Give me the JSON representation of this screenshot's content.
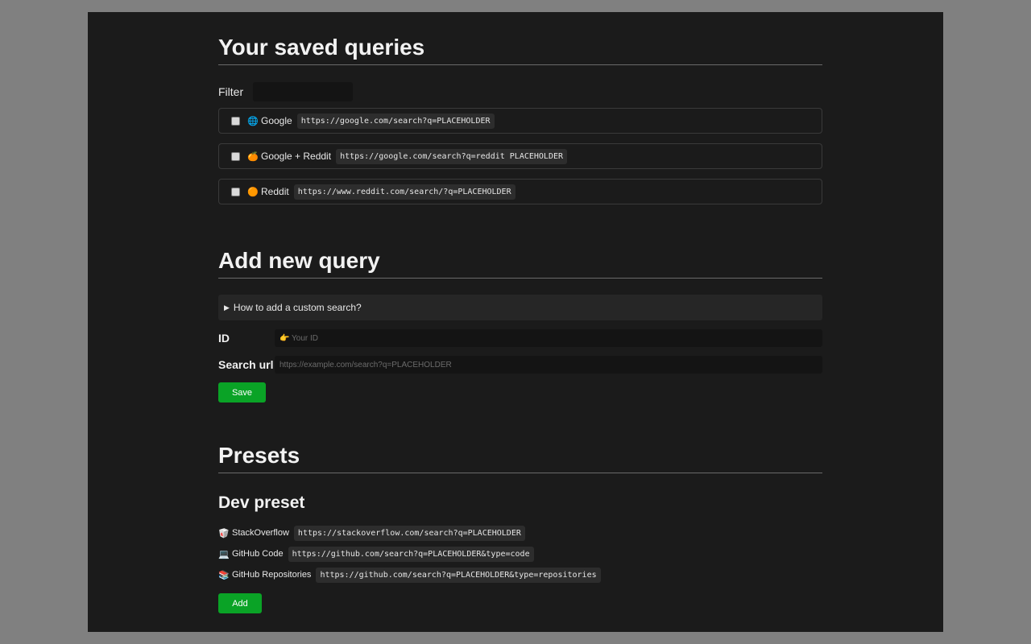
{
  "saved": {
    "title": "Your saved queries",
    "filter_label": "Filter",
    "filter_value": "",
    "items": [
      {
        "icon": "🌐",
        "icon_name": "globe-icon",
        "name": "Google",
        "url": "https://google.com/search?q=PLACEHOLDER"
      },
      {
        "icon": "🍊",
        "icon_name": "orange-icon",
        "name": "Google + Reddit",
        "url": "https://google.com/search?q=reddit PLACEHOLDER"
      },
      {
        "icon": "🟠",
        "icon_name": "orange-circle-icon",
        "name": "Reddit",
        "url": "https://www.reddit.com/search/?q=PLACEHOLDER"
      }
    ]
  },
  "add": {
    "title": "Add new query",
    "help_summary": "How to add a custom search?",
    "help_marker": "▶",
    "id_label": "ID",
    "id_placeholder": "👉 Your ID",
    "url_label": "Search url",
    "url_placeholder": "https://example.com/search?q=PLACEHOLDER",
    "save_label": "Save"
  },
  "presets": {
    "title": "Presets",
    "preset_name": "Dev preset",
    "items": [
      {
        "icon": "🥡",
        "icon_name": "takeout-box-icon",
        "name": "StackOverflow",
        "url": "https://stackoverflow.com/search?q=PLACEHOLDER"
      },
      {
        "icon": "💻",
        "icon_name": "laptop-icon",
        "name": "GitHub Code",
        "url": "https://github.com/search?q=PLACEHOLDER&type=code"
      },
      {
        "icon": "📚",
        "icon_name": "books-icon",
        "name": "GitHub Repositories",
        "url": "https://github.com/search?q=PLACEHOLDER&type=repositories"
      }
    ],
    "add_label": "Add"
  },
  "colors": {
    "page_background": "#1b1b1b",
    "outer_background": "#808080",
    "accent_green": "#0aa326",
    "code_background": "#2d2d2d"
  }
}
